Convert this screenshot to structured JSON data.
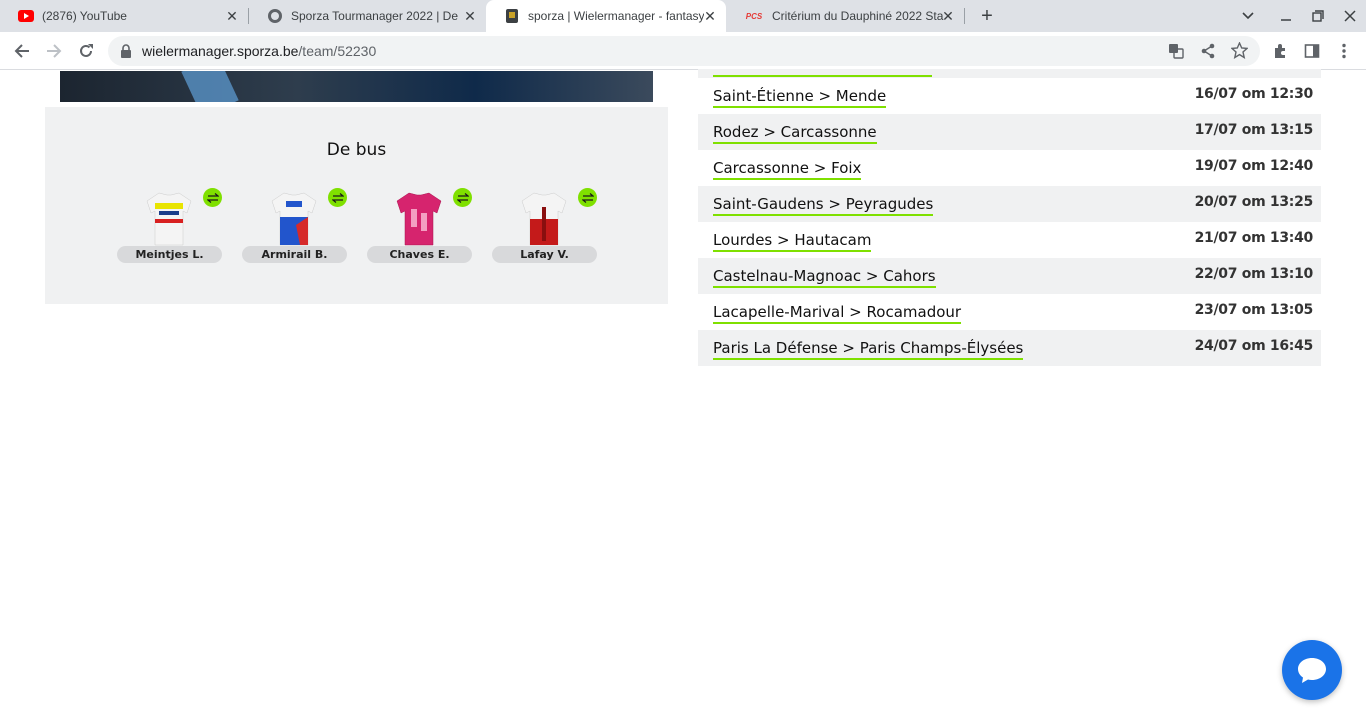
{
  "browser": {
    "tabs": [
      {
        "title": "(2876) YouTube",
        "icon": "youtube-icon"
      },
      {
        "title": "Sporza Tourmanager 2022 | De l",
        "icon": "sporza-icon"
      },
      {
        "title": "sporza | Wielermanager - fantasy",
        "icon": "wielermanager-icon"
      },
      {
        "title": "Critérium du Dauphiné 2022 Sta",
        "icon": "pcs-icon"
      }
    ],
    "pcs_label": "PCS",
    "url_host": "wielermanager.sporza.be",
    "url_path": "/team/52230"
  },
  "bus": {
    "title": "De bus",
    "riders": [
      {
        "name": "Meintjes L.",
        "jersey_color": "#e8e400"
      },
      {
        "name": "Armirail B.",
        "jersey_color": "#2255cc"
      },
      {
        "name": "Chaves E.",
        "jersey_color": "#d6246e"
      },
      {
        "name": "Lafay V.",
        "jersey_color": "#c41a1a"
      }
    ]
  },
  "stages": [
    {
      "name": "Saint-Étienne > Mende",
      "time": "16/07 om 12:30"
    },
    {
      "name": "Rodez > Carcassonne",
      "time": "17/07 om 13:15"
    },
    {
      "name": "Carcassonne > Foix",
      "time": "19/07 om 12:40"
    },
    {
      "name": "Saint-Gaudens > Peyragudes",
      "time": "20/07 om 13:25"
    },
    {
      "name": "Lourdes > Hautacam",
      "time": "21/07 om 13:40"
    },
    {
      "name": "Castelnau-Magnoac > Cahors",
      "time": "22/07 om 13:10"
    },
    {
      "name": "Lacapelle-Marival > Rocamadour",
      "time": "23/07 om 13:05"
    },
    {
      "name": "Paris La Défense > Paris Champs-Élysées",
      "time": "24/07 om 16:45"
    }
  ],
  "colors": {
    "accent": "#7fe000",
    "panel": "#f0f1f2",
    "chat": "#1a73e8"
  }
}
